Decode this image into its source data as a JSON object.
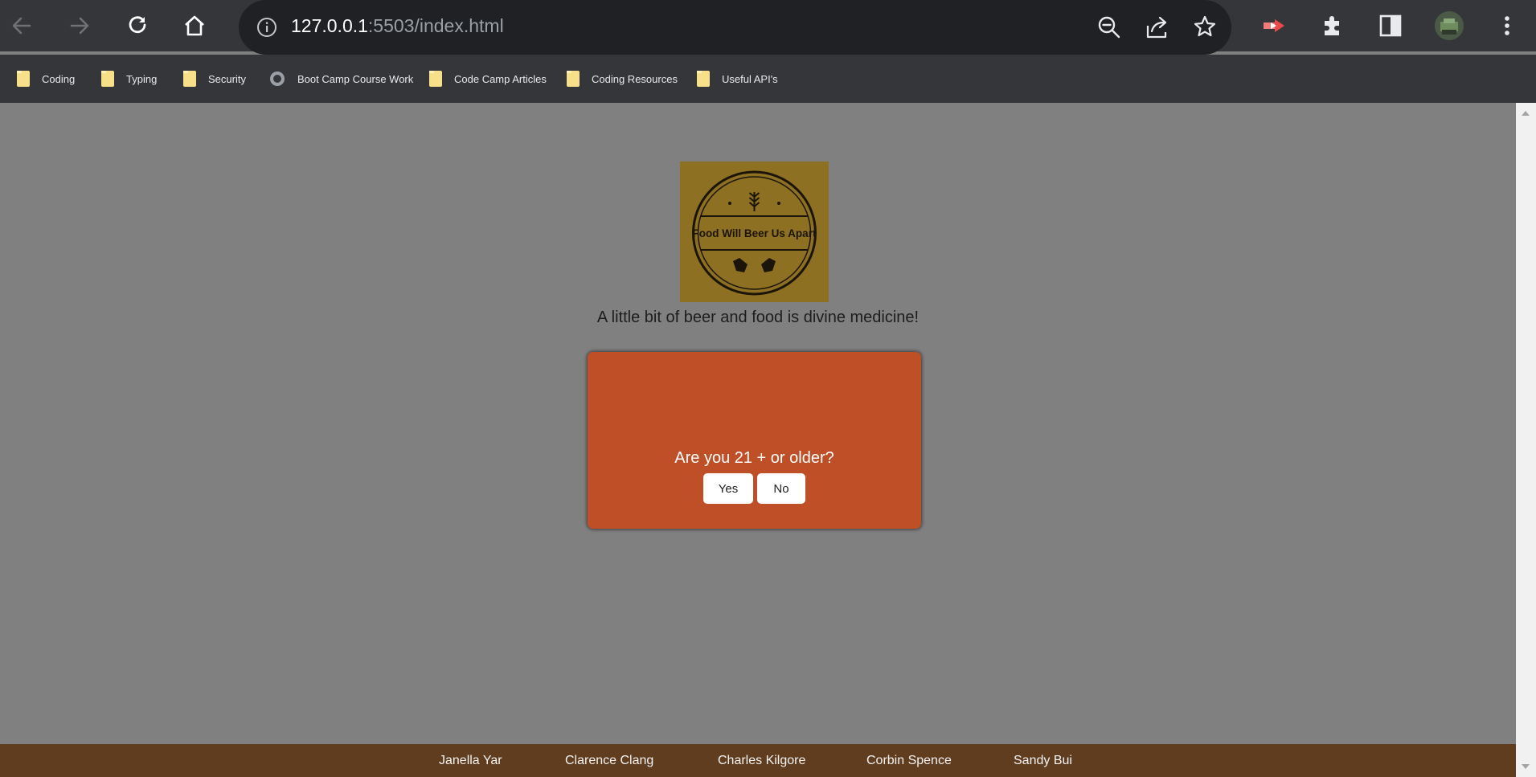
{
  "browser": {
    "url_host": "127.0.0.1",
    "url_rest": ":5503/index.html",
    "bookmarks": [
      {
        "label": "Coding",
        "icon": "folder-icon"
      },
      {
        "label": "Typing",
        "icon": "folder-icon"
      },
      {
        "label": "Security",
        "icon": "folder-icon"
      },
      {
        "label": "Boot Camp Course Work",
        "icon": "github-icon"
      },
      {
        "label": "Code Camp Articles",
        "icon": "folder-icon"
      },
      {
        "label": "Coding Resources",
        "icon": "folder-icon"
      },
      {
        "label": "Useful API's",
        "icon": "folder-icon"
      }
    ]
  },
  "page": {
    "logo_text": "Food Will Beer Us Apart",
    "tagline": "A little bit of beer and food is divine medicine!",
    "modal": {
      "question": "Are you 21 + or older?",
      "yes_label": "Yes",
      "no_label": "No",
      "background_color": "#bf4f27"
    },
    "footer": {
      "names": [
        "Janella Yar",
        "Clarence Clang",
        "Charles Kilgore",
        "Corbin Spence",
        "Sandy Bui"
      ],
      "background_color": "#603d1f"
    }
  }
}
